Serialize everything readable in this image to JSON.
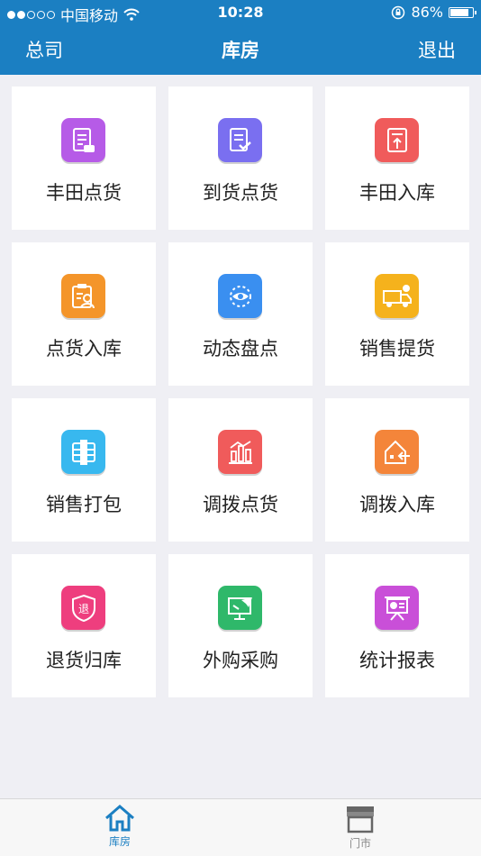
{
  "status_bar": {
    "carrier": "中国移动",
    "time": "10:28",
    "battery": "86%"
  },
  "nav": {
    "back_label": "总司",
    "title": "库房",
    "logout_label": "退出"
  },
  "tiles": [
    {
      "label": "丰田点货",
      "icon": "toyota-count-icon",
      "color": "#b65be7"
    },
    {
      "label": "到货点货",
      "icon": "arrival-count-icon",
      "color": "#7a6ff0"
    },
    {
      "label": "丰田入库",
      "icon": "toyota-stock-in-icon",
      "color": "#f05b5b"
    },
    {
      "label": "点货入库",
      "icon": "count-stock-in-icon",
      "color": "#f4952a"
    },
    {
      "label": "动态盘点",
      "icon": "dynamic-inventory-icon",
      "color": "#3a8ff0"
    },
    {
      "label": "销售提货",
      "icon": "sales-pickup-icon",
      "color": "#f5b21c"
    },
    {
      "label": "销售打包",
      "icon": "sales-pack-icon",
      "color": "#38b8ef"
    },
    {
      "label": "调拨点货",
      "icon": "transfer-count-icon",
      "color": "#f05b5b"
    },
    {
      "label": "调拨入库",
      "icon": "transfer-stock-in-icon",
      "color": "#f4853a"
    },
    {
      "label": "退货归库",
      "icon": "return-stock-icon",
      "color": "#ee3e7e"
    },
    {
      "label": "外购采购",
      "icon": "purchase-icon",
      "color": "#2fb86a"
    },
    {
      "label": "统计报表",
      "icon": "report-icon",
      "color": "#c94fd8"
    }
  ],
  "tabbar": [
    {
      "label": "库房",
      "icon": "home-icon",
      "active": true
    },
    {
      "label": "门市",
      "icon": "store-icon",
      "active": false
    }
  ]
}
